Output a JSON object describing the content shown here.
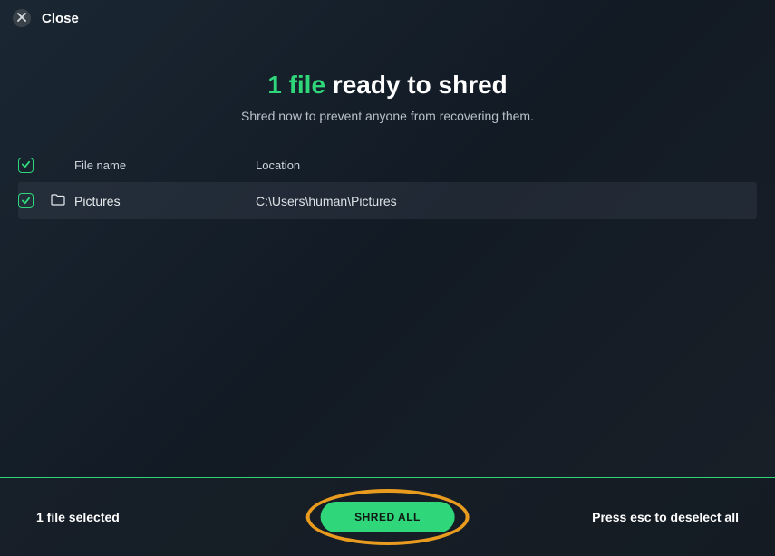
{
  "header": {
    "close_label": "Close"
  },
  "title": {
    "count_text": "1 file",
    "rest_text": " ready to shred"
  },
  "subtitle": "Shred now to prevent anyone from recovering them.",
  "columns": {
    "name": "File name",
    "location": "Location"
  },
  "rows": [
    {
      "name": "Pictures",
      "location": "C:\\Users\\human\\Pictures"
    }
  ],
  "footer": {
    "selected_text": "1 file selected",
    "shred_button": "SHRED ALL",
    "deselect_hint": "Press esc to deselect all"
  }
}
